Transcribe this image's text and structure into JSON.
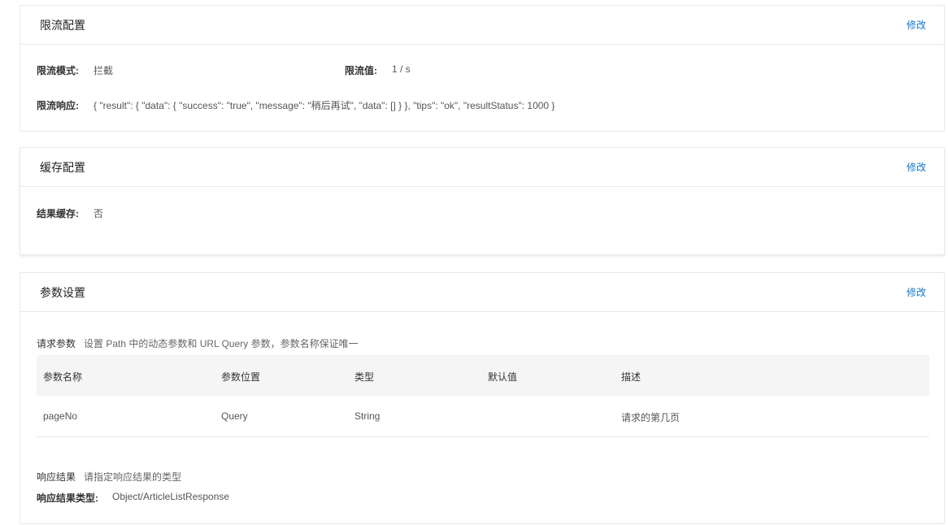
{
  "rate_limit": {
    "title": "限流配置",
    "edit": "修改",
    "mode_label": "限流模式:",
    "mode_value": "拦截",
    "limit_label": "限流值:",
    "limit_value": "1 / s",
    "response_label": "限流响应:",
    "response_value": "{ \"result\": { \"data\": { \"success\": \"true\", \"message\": \"稍后再试\", \"data\": [] } }, \"tips\": \"ok\", \"resultStatus\": 1000 }"
  },
  "cache": {
    "title": "缓存配置",
    "edit": "修改",
    "result_cache_label": "结果缓存:",
    "result_cache_value": "否"
  },
  "params": {
    "title": "参数设置",
    "edit": "修改",
    "request_label": "请求参数",
    "request_hint": "设置 Path 中的动态参数和 URL Query 参数，参数名称保证唯一",
    "columns": [
      "参数名称",
      "参数位置",
      "类型",
      "默认值",
      "描述"
    ],
    "rows": [
      [
        "pageNo",
        "Query",
        "String",
        "",
        "请求的第几页"
      ]
    ],
    "response_label": "响应结果",
    "response_hint": "请指定响应结果的类型",
    "response_type_label": "响应结果类型:",
    "response_type_value": "Object/ArticleListResponse"
  }
}
